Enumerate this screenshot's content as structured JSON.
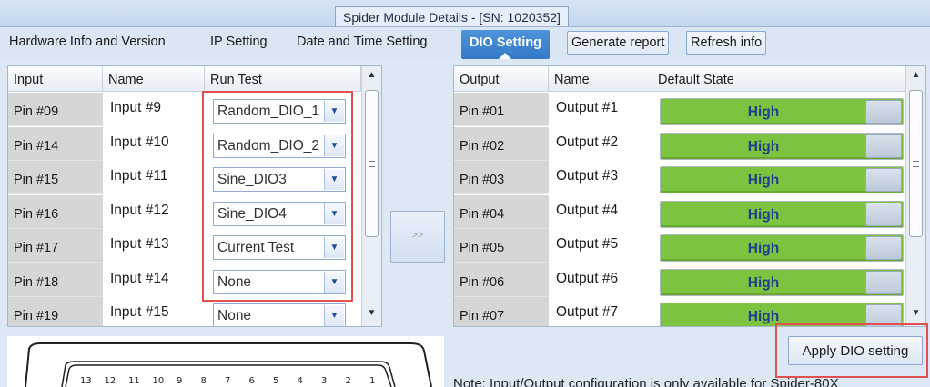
{
  "window": {
    "title": "Spider Module Details - [SN: 1020352]"
  },
  "tabs": [
    {
      "label": "Hardware Info and Version"
    },
    {
      "label": "IP Setting"
    },
    {
      "label": "Date and Time Setting"
    },
    {
      "label": "DIO Setting",
      "active": true
    }
  ],
  "toolbar": {
    "generate_label": "Generate report",
    "refresh_label": "Refresh info"
  },
  "input_grid": {
    "headers": [
      "Input",
      "Name",
      "Run Test"
    ],
    "rows": [
      {
        "pin": "Pin #09",
        "name": "Input  #9",
        "run_test": "Random_DIO_1"
      },
      {
        "pin": "Pin #14",
        "name": "Input  #10",
        "run_test": "Random_DIO_2"
      },
      {
        "pin": "Pin #15",
        "name": "Input  #11",
        "run_test": "Sine_DIO3"
      },
      {
        "pin": "Pin #16",
        "name": "Input  #12",
        "run_test": "Sine_DIO4"
      },
      {
        "pin": "Pin #17",
        "name": "Input  #13",
        "run_test": "Current Test"
      },
      {
        "pin": "Pin #18",
        "name": "Input  #14",
        "run_test": "None"
      },
      {
        "pin": "Pin #19",
        "name": "Input  #15",
        "run_test": "None"
      }
    ]
  },
  "move_button": {
    "label": ">>"
  },
  "output_grid": {
    "headers": [
      "Output",
      "Name",
      "Default State"
    ],
    "rows": [
      {
        "pin": "Pin #01",
        "name": "Output #1",
        "state": "High"
      },
      {
        "pin": "Pin #02",
        "name": "Output #2",
        "state": "High"
      },
      {
        "pin": "Pin #03",
        "name": "Output #3",
        "state": "High"
      },
      {
        "pin": "Pin #04",
        "name": "Output #4",
        "state": "High"
      },
      {
        "pin": "Pin #05",
        "name": "Output #5",
        "state": "High"
      },
      {
        "pin": "Pin #06",
        "name": "Output #6",
        "state": "High"
      },
      {
        "pin": "Pin #07",
        "name": "Output #7",
        "state": "High"
      }
    ]
  },
  "apply_label": "Apply DIO setting",
  "connector": {
    "pins": [
      "13",
      "12",
      "11",
      "10",
      "9",
      "8",
      "7",
      "6",
      "5",
      "4",
      "3",
      "2",
      "1"
    ]
  },
  "note": "Note: Input/Output configuration is only available for Spider-80X"
}
